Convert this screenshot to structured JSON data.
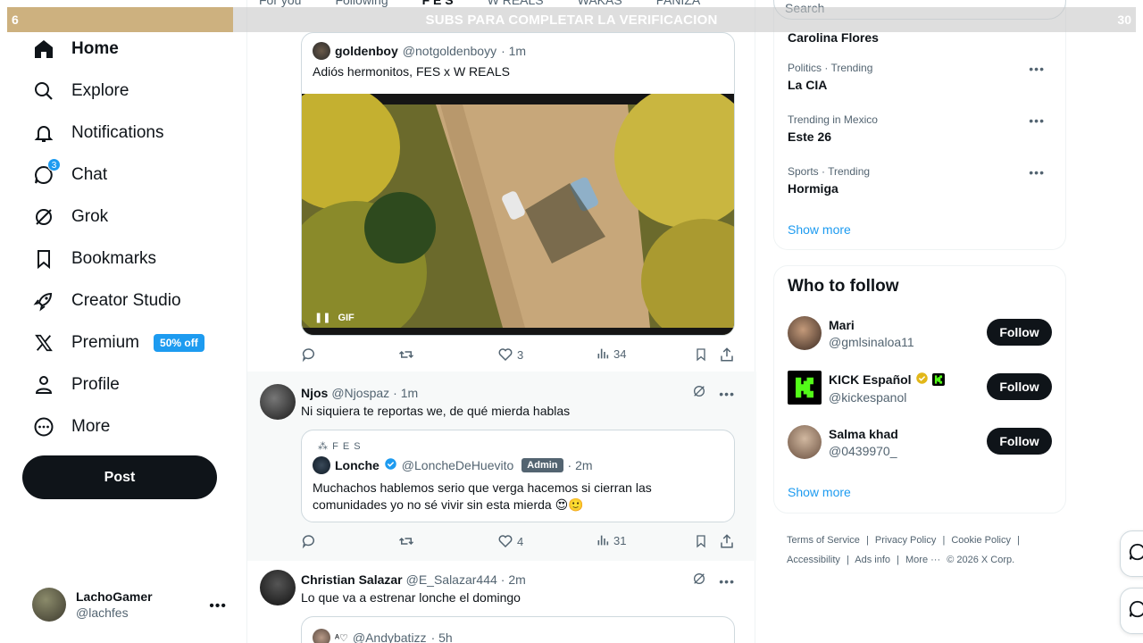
{
  "banner": {
    "left_number": "6",
    "right_number": "30",
    "text": "SUBS PARA COMPLETAR LA VERIFICACION"
  },
  "top_tabs": [
    "For you",
    "Following",
    "F E S",
    "W REALS",
    "WAKAS",
    "PANIZA"
  ],
  "search": {
    "placeholder": "Search"
  },
  "nav": {
    "items": [
      {
        "label": "Home",
        "icon": "home-icon"
      },
      {
        "label": "Explore",
        "icon": "search-icon"
      },
      {
        "label": "Notifications",
        "icon": "bell-icon"
      },
      {
        "label": "Chat",
        "icon": "chat-icon",
        "badge": "3"
      },
      {
        "label": "Grok",
        "icon": "grok-icon"
      },
      {
        "label": "Bookmarks",
        "icon": "bookmark-icon"
      },
      {
        "label": "Creator Studio",
        "icon": "rocket-icon"
      },
      {
        "label": "Premium",
        "icon": "x-logo-icon",
        "promo": "50% off"
      },
      {
        "label": "Profile",
        "icon": "person-icon"
      },
      {
        "label": "More",
        "icon": "more-circle-icon"
      }
    ],
    "post_label": "Post"
  },
  "account": {
    "display_name": "LachoGamer",
    "handle": "@lachfes"
  },
  "feed": {
    "quoted_top": {
      "name": "goldenboy",
      "handle": "@notgoldenboyy",
      "time": "· 1m",
      "text": "Adiós hermonitos, FES x W REALS",
      "media_label": "GIF",
      "stats": {
        "replies": "",
        "reposts": "",
        "likes": "3",
        "views": "34"
      }
    },
    "tweet2": {
      "name": "Njos",
      "handle": "@Njospaz",
      "time": "· 1m",
      "text": "Ni siquiera te reportas we, de qué mierda hablas",
      "quote": {
        "community": "F E S",
        "name": "Lonche",
        "handle": "@LoncheDeHuevito",
        "role": "Admin",
        "time": "· 2m",
        "text": "Muchachos hablemos serio que verga hacemos si cierran las comunidades yo no sé vivir sin esta mierda 😍🙂"
      },
      "stats": {
        "likes": "4",
        "views": "31"
      }
    },
    "tweet3": {
      "name": "Christian Salazar",
      "handle": "@E_Salazar444",
      "time": "· 2m",
      "text": "Lo que va a estrenar lonche el domingo",
      "quote": {
        "name": "ᴬ♡",
        "handle": "@Andybatizz",
        "time": "· 5h"
      }
    }
  },
  "trends": [
    {
      "meta": "",
      "name": "Carolina Flores"
    },
    {
      "meta": "Politics · Trending",
      "name": "La CIA"
    },
    {
      "meta": "Trending in Mexico",
      "name": "Este 26"
    },
    {
      "meta": "Sports · Trending",
      "name": "Hormiga"
    }
  ],
  "show_more": "Show more",
  "who_to_follow": {
    "title": "Who to follow",
    "users": [
      {
        "name": "Mari",
        "handle": "@gmlsinaloa11",
        "follow": "Follow"
      },
      {
        "name": "KICK Español",
        "handle": "@kickespanol",
        "follow": "Follow"
      },
      {
        "name": "Salma khad",
        "handle": "@0439970_",
        "follow": "Follow"
      }
    ],
    "show_more": "Show more"
  },
  "footer": {
    "links": [
      "Terms of Service",
      "|",
      "Privacy Policy",
      "|",
      "Cookie Policy",
      "|",
      "Accessibility",
      "|",
      "Ads info",
      "|",
      "More ···",
      "© 2026 X Corp."
    ]
  },
  "colors": {
    "accent": "#1d9bf0",
    "text": "#0f1419",
    "muted": "#536471",
    "banner_fill": "#cdb17f"
  }
}
